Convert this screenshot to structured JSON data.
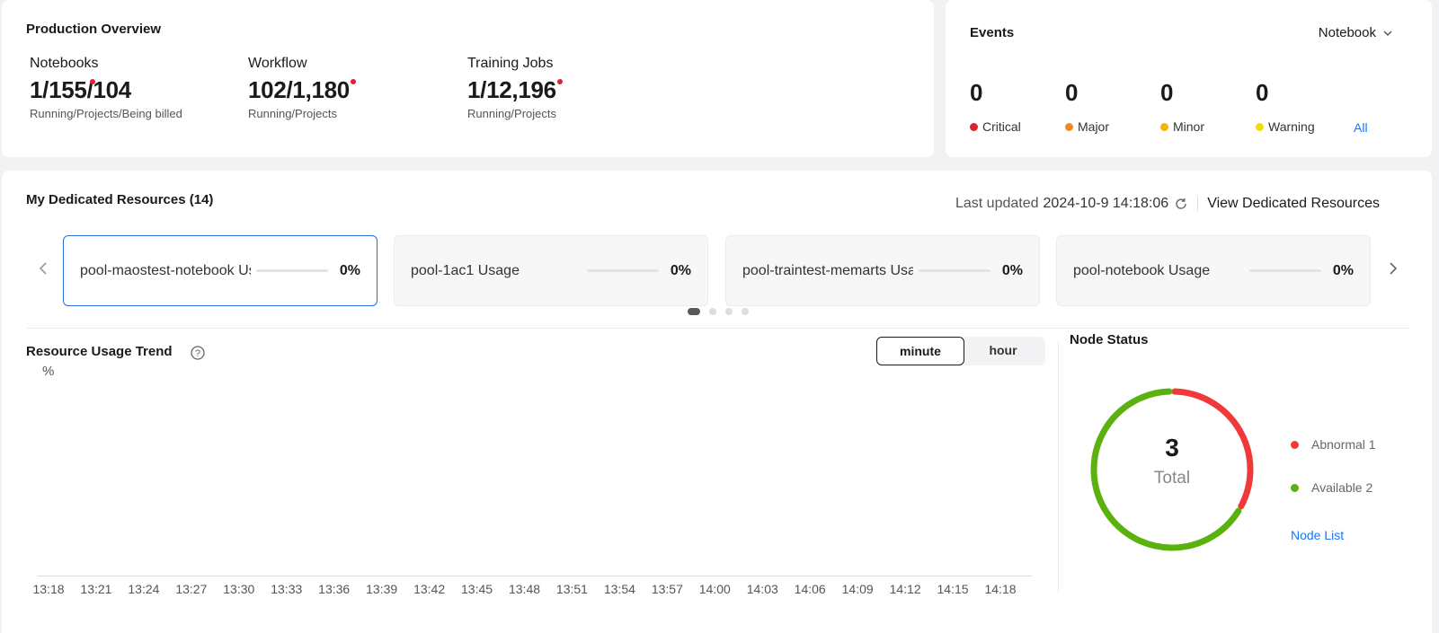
{
  "overview": {
    "title": "Production Overview",
    "stats": [
      {
        "label": "Notebooks",
        "value": "1/155/104",
        "sub": "Running/Projects/Being billed"
      },
      {
        "label": "Workflow",
        "value": "102/1,180",
        "sub": "Running/Projects"
      },
      {
        "label": "Training Jobs",
        "value": "1/12,196",
        "sub": "Running/Projects"
      }
    ]
  },
  "events": {
    "title": "Events",
    "filter": "Notebook",
    "levels": [
      {
        "count": "0",
        "label": "Critical",
        "color": "#e0212f"
      },
      {
        "count": "0",
        "label": "Major",
        "color": "#f08a1d"
      },
      {
        "count": "0",
        "label": "Minor",
        "color": "#f5b400"
      },
      {
        "count": "0",
        "label": "Warning",
        "color": "#f2dd00"
      }
    ],
    "all_link": "All"
  },
  "dedicated": {
    "title": "My Dedicated Resources (14)",
    "last_updated_label": "Last updated",
    "last_updated": "2024-10-9 14:18:06",
    "view_link": "View Dedicated Resources",
    "pools": [
      {
        "name": "pool-maostest-notebook Usage",
        "usage": 0,
        "pct": "0%"
      },
      {
        "name": "pool-1ac1 Usage",
        "usage": 0,
        "pct": "0%"
      },
      {
        "name": "pool-traintest-memarts Usage",
        "usage": 0,
        "pct": "0%"
      },
      {
        "name": "pool-notebook Usage",
        "usage": 0,
        "pct": "0%"
      }
    ],
    "pager": {
      "pages": 4,
      "current": 1
    }
  },
  "trend": {
    "title": "Resource Usage Trend",
    "unit": "%",
    "toggle": {
      "minute": "minute",
      "hour": "hour",
      "selected": "minute"
    }
  },
  "chart_data": {
    "type": "line",
    "title": "Resource Usage Trend",
    "ylabel": "%",
    "x": [
      "13:18",
      "13:21",
      "13:24",
      "13:27",
      "13:30",
      "13:33",
      "13:36",
      "13:39",
      "13:42",
      "13:45",
      "13:48",
      "13:51",
      "13:54",
      "13:57",
      "14:00",
      "14:03",
      "14:06",
      "14:09",
      "14:12",
      "14:15",
      "14:18"
    ],
    "series": []
  },
  "node_status": {
    "title": "Node Status",
    "total": "3",
    "total_label": "Total",
    "items": [
      {
        "label": "Abnormal 1",
        "count": 1,
        "color": "#f03a3a"
      },
      {
        "label": "Available 2",
        "count": 2,
        "color": "#5bb10e"
      }
    ],
    "link": "Node List"
  }
}
